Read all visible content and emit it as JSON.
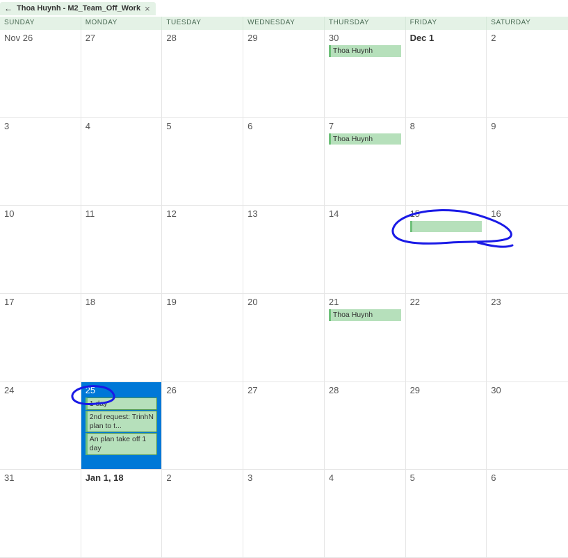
{
  "tab": {
    "back_glyph": "←",
    "title": "Thoa Huynh - M2_Team_Off_Work",
    "close_glyph": "×"
  },
  "day_headers": [
    "SUNDAY",
    "MONDAY",
    "TUESDAY",
    "WEDNESDAY",
    "THURSDAY",
    "FRIDAY",
    "SATURDAY"
  ],
  "weeks": [
    [
      {
        "label": "Nov 26",
        "bold": false,
        "selected": false,
        "events": []
      },
      {
        "label": "27",
        "bold": false,
        "selected": false,
        "events": []
      },
      {
        "label": "28",
        "bold": false,
        "selected": false,
        "events": []
      },
      {
        "label": "29",
        "bold": false,
        "selected": false,
        "events": []
      },
      {
        "label": "30",
        "bold": false,
        "selected": false,
        "events": [
          {
            "text": "Thoa Huynh"
          }
        ]
      },
      {
        "label": "Dec 1",
        "bold": true,
        "selected": false,
        "events": []
      },
      {
        "label": "2",
        "bold": false,
        "selected": false,
        "events": []
      }
    ],
    [
      {
        "label": "3",
        "bold": false,
        "selected": false,
        "events": []
      },
      {
        "label": "4",
        "bold": false,
        "selected": false,
        "events": []
      },
      {
        "label": "5",
        "bold": false,
        "selected": false,
        "events": []
      },
      {
        "label": "6",
        "bold": false,
        "selected": false,
        "events": []
      },
      {
        "label": "7",
        "bold": false,
        "selected": false,
        "events": [
          {
            "text": "Thoa Huynh"
          }
        ]
      },
      {
        "label": "8",
        "bold": false,
        "selected": false,
        "events": []
      },
      {
        "label": "9",
        "bold": false,
        "selected": false,
        "events": []
      }
    ],
    [
      {
        "label": "10",
        "bold": false,
        "selected": false,
        "events": []
      },
      {
        "label": "11",
        "bold": false,
        "selected": false,
        "events": []
      },
      {
        "label": "12",
        "bold": false,
        "selected": false,
        "events": []
      },
      {
        "label": "13",
        "bold": false,
        "selected": false,
        "events": []
      },
      {
        "label": "14",
        "bold": false,
        "selected": false,
        "events": []
      },
      {
        "label": "15",
        "bold": false,
        "selected": false,
        "events": [
          {
            "text": ""
          }
        ]
      },
      {
        "label": "16",
        "bold": false,
        "selected": false,
        "events": []
      }
    ],
    [
      {
        "label": "17",
        "bold": false,
        "selected": false,
        "events": []
      },
      {
        "label": "18",
        "bold": false,
        "selected": false,
        "events": []
      },
      {
        "label": "19",
        "bold": false,
        "selected": false,
        "events": []
      },
      {
        "label": "20",
        "bold": false,
        "selected": false,
        "events": []
      },
      {
        "label": "21",
        "bold": false,
        "selected": false,
        "events": [
          {
            "text": "Thoa Huynh"
          }
        ]
      },
      {
        "label": "22",
        "bold": false,
        "selected": false,
        "events": []
      },
      {
        "label": "23",
        "bold": false,
        "selected": false,
        "events": []
      }
    ],
    [
      {
        "label": "24",
        "bold": false,
        "selected": false,
        "events": []
      },
      {
        "label": "25",
        "bold": false,
        "selected": true,
        "events": [
          {
            "text": "1 day"
          },
          {
            "text": "2nd request: TrinhN  plan to t..."
          },
          {
            "text": "An plan take off 1 day"
          }
        ]
      },
      {
        "label": "26",
        "bold": false,
        "selected": false,
        "events": []
      },
      {
        "label": "27",
        "bold": false,
        "selected": false,
        "events": []
      },
      {
        "label": "28",
        "bold": false,
        "selected": false,
        "events": []
      },
      {
        "label": "29",
        "bold": false,
        "selected": false,
        "events": []
      },
      {
        "label": "30",
        "bold": false,
        "selected": false,
        "events": []
      }
    ],
    [
      {
        "label": "31",
        "bold": false,
        "selected": false,
        "events": []
      },
      {
        "label": "Jan 1, 18",
        "bold": true,
        "selected": false,
        "events": []
      },
      {
        "label": "2",
        "bold": false,
        "selected": false,
        "events": []
      },
      {
        "label": "3",
        "bold": false,
        "selected": false,
        "events": []
      },
      {
        "label": "4",
        "bold": false,
        "selected": false,
        "events": []
      },
      {
        "label": "5",
        "bold": false,
        "selected": false,
        "events": []
      },
      {
        "label": "6",
        "bold": false,
        "selected": false,
        "events": []
      }
    ]
  ]
}
